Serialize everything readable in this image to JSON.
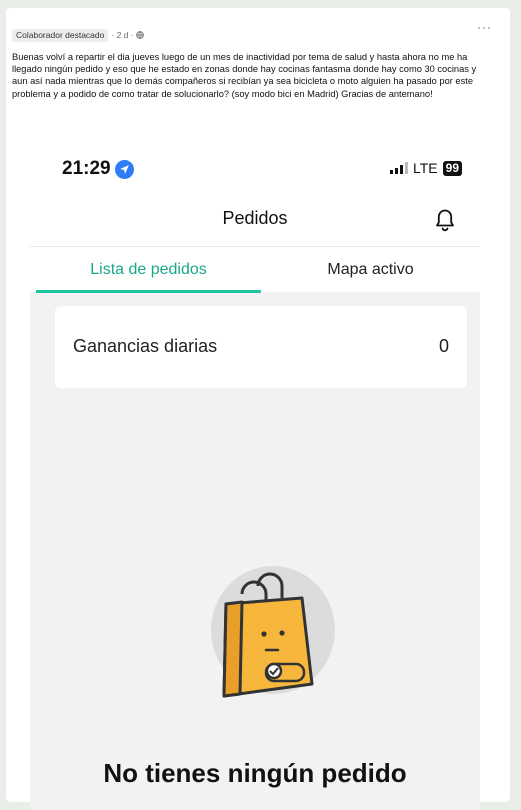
{
  "post": {
    "badge": "Colaborador destacado",
    "meta": "· 2 d ·",
    "more": "···",
    "text": "Buenas volví a repartir el dia jueves luego de un mes de inactividad por tema de salud y hasta ahora no me ha llegado ningún pedido y eso que he estado en zonas donde hay cocinas fantasma donde hay como 30 cocinas y aun así nada mientras que lo demás compañeros si recibían ya sea bicicleta o moto alguien ha pasado por este problema y a podido de como tratar de solucionarlo? (soy modo bici en Madrid) Gracias de antemano!"
  },
  "phone": {
    "status": {
      "time": "21:29",
      "network": "LTE",
      "battery": "99"
    },
    "title": "Pedidos",
    "tabs": [
      {
        "label": "Lista de pedidos",
        "active": true
      },
      {
        "label": "Mapa activo",
        "active": false
      }
    ],
    "earnings": {
      "label": "Ganancias diarias",
      "value": "0"
    },
    "empty_message": "No tienes ningún pedido"
  },
  "colors": {
    "accent": "#1aa789",
    "underline": "#1fc4a0",
    "bag": "#f6b73c",
    "location": "#2f7cf6"
  },
  "icons": [
    "globe-icon",
    "location-arrow-icon",
    "signal-icon",
    "bell-icon",
    "shopping-bag-illustration"
  ]
}
